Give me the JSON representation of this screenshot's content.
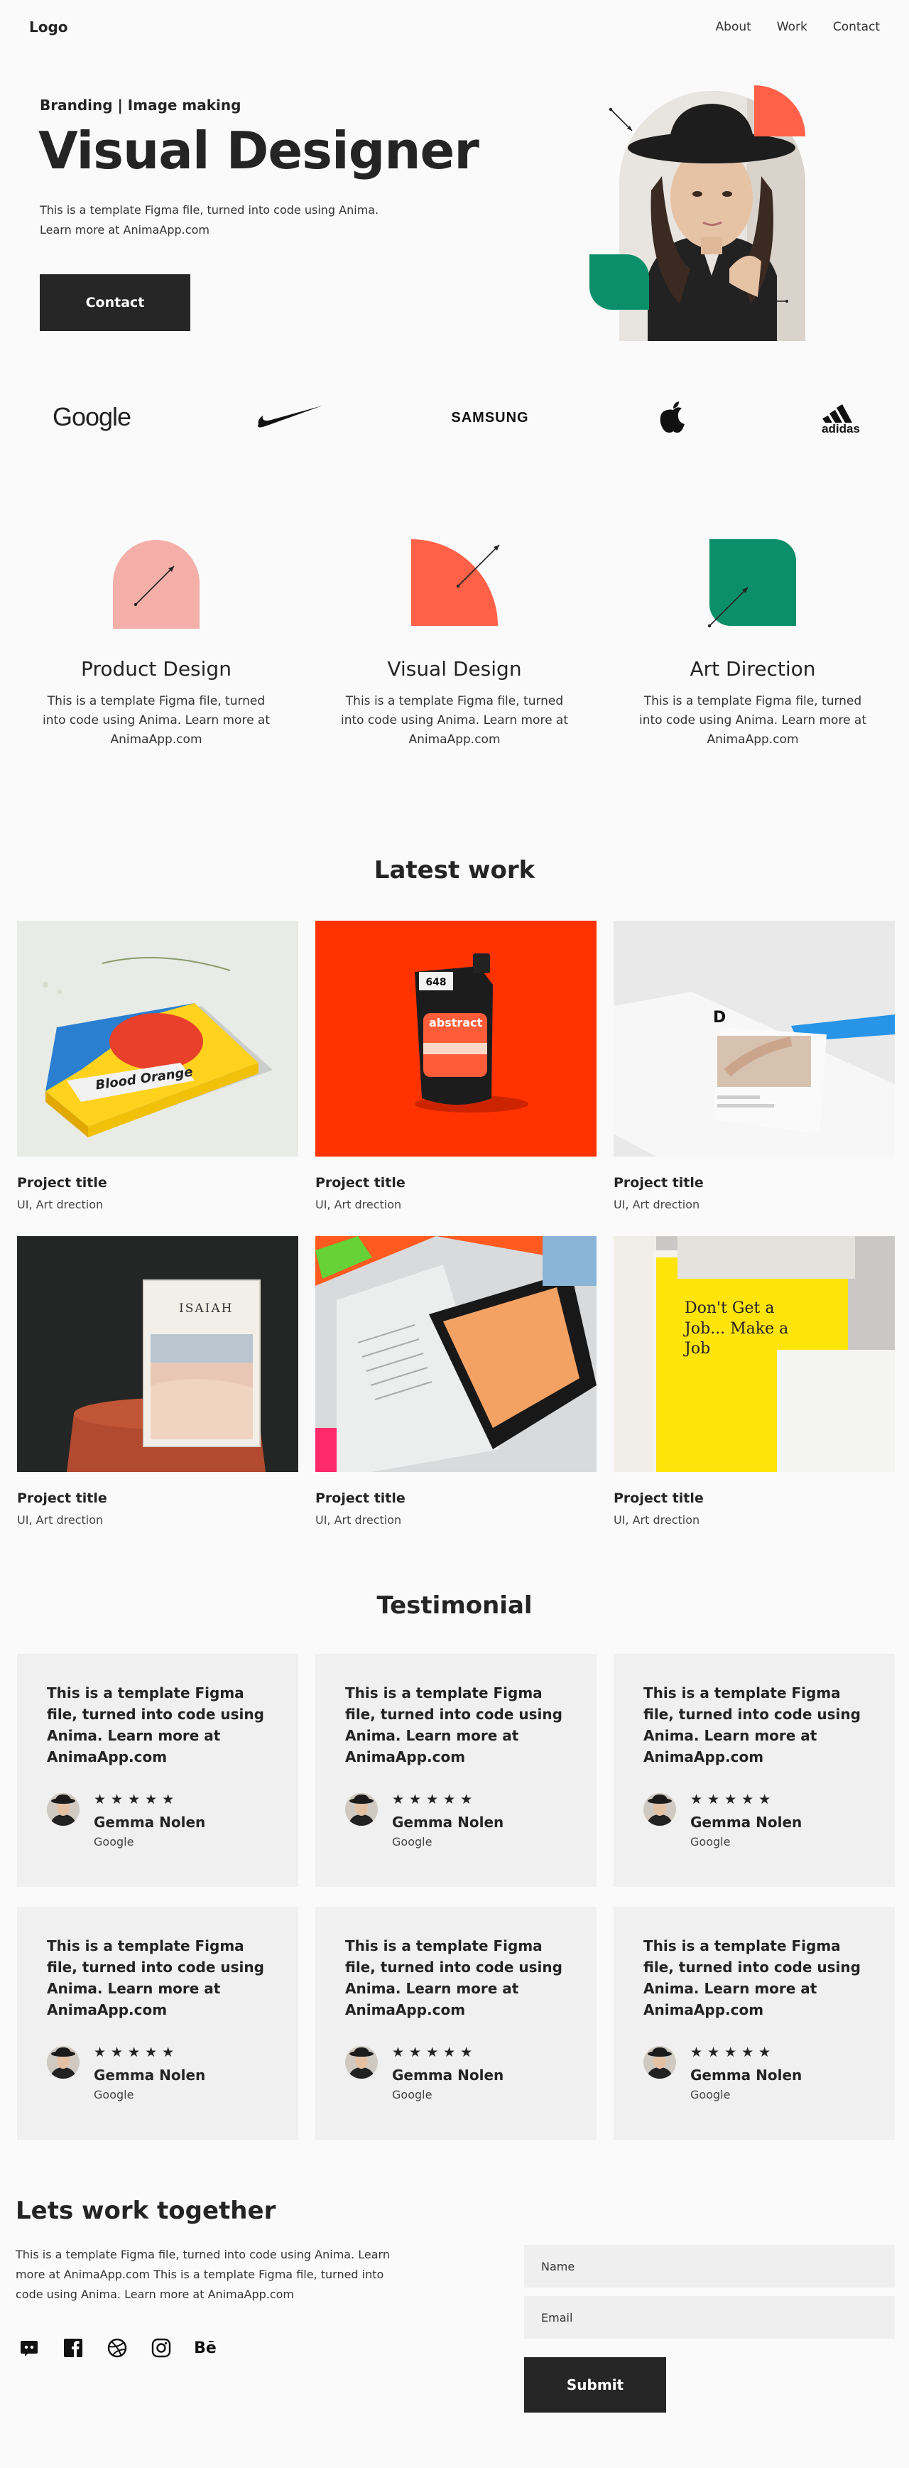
{
  "nav": {
    "logo": "Logo",
    "links": [
      "About",
      "Work",
      "Contact"
    ]
  },
  "hero": {
    "kicker": "Branding | Image making",
    "title": "Visual Designer",
    "description": "This is a template Figma file, turned into code using Anima. Learn more at AnimaApp.com",
    "cta_label": "Contact"
  },
  "brands": [
    "Google",
    "Nike",
    "SAMSUNG",
    "Apple",
    "adidas"
  ],
  "services": [
    {
      "title": "Product Design",
      "description": "This is a template Figma file, turned into code using Anima. Learn more at AnimaApp.com",
      "color": "#f4b0a8"
    },
    {
      "title": "Visual Design",
      "description": "This is a template Figma file, turned into code using Anima. Learn more at AnimaApp.com",
      "color": "#ff6048"
    },
    {
      "title": "Art Direction",
      "description": "This is a template Figma file, turned into code using Anima. Learn more at AnimaApp.com",
      "color": "#0a8f6a"
    }
  ],
  "work": {
    "title": "Latest work",
    "projects": [
      {
        "title": "Project title",
        "subtitle": "UI, Art drection",
        "image": "blood-orange-book",
        "image_text": "Blood Orange"
      },
      {
        "title": "Project title",
        "subtitle": "UI, Art drection",
        "image": "paint-pouch",
        "image_text": "abstract"
      },
      {
        "title": "Project title",
        "subtitle": "UI, Art drection",
        "image": "booklet-spread",
        "image_text": "D"
      },
      {
        "title": "Project title",
        "subtitle": "UI, Art drection",
        "image": "isaiah-book",
        "image_text": "ISAIAH"
      },
      {
        "title": "Project title",
        "subtitle": "UI, Art drection",
        "image": "magazine-spread",
        "image_text": ""
      },
      {
        "title": "Project title",
        "subtitle": "UI, Art drection",
        "image": "yellow-books",
        "image_text": "Don't Get a Job... Make a Job"
      }
    ]
  },
  "testimonials": {
    "title": "Testimonial",
    "items": [
      {
        "quote": "This is a template Figma file, turned into code using Anima. Learn more at AnimaApp.com",
        "stars": "★★★★★",
        "name": "Gemma Nolen",
        "company": "Google"
      },
      {
        "quote": "This is a template Figma file, turned into code using Anima. Learn more at AnimaApp.com",
        "stars": "★★★★★",
        "name": "Gemma Nolen",
        "company": "Google"
      },
      {
        "quote": "This is a template Figma file, turned into code using Anima. Learn more at AnimaApp.com",
        "stars": "★★★★★",
        "name": "Gemma Nolen",
        "company": "Google"
      },
      {
        "quote": "This is a template Figma file, turned into code using Anima. Learn more at AnimaApp.com",
        "stars": "★★★★★",
        "name": "Gemma Nolen",
        "company": "Google"
      },
      {
        "quote": "This is a template Figma file, turned into code using Anima. Learn more at AnimaApp.com",
        "stars": "★★★★★",
        "name": "Gemma Nolen",
        "company": "Google"
      },
      {
        "quote": "This is a template Figma file, turned into code using Anima. Learn more at AnimaApp.com",
        "stars": "★★★★★",
        "name": "Gemma Nolen",
        "company": "Google"
      }
    ]
  },
  "contact": {
    "title": "Lets work together",
    "description": "This is a template Figma file, turned into code using Anima. Learn more at AnimaApp.com This is a template Figma file, turned into code using Anima. Learn more at AnimaApp.com",
    "socials": [
      "discord-icon",
      "facebook-icon",
      "dribbble-icon",
      "instagram-icon",
      "behance-icon"
    ],
    "behance_label": "Bē",
    "name_placeholder": "Name",
    "email_placeholder": "Email",
    "submit_label": "Submit"
  },
  "colors": {
    "dark": "#262626",
    "coral": "#ff6048",
    "pink": "#f4b0a8",
    "green": "#0a8f6a",
    "card": "#f0f0f0"
  }
}
